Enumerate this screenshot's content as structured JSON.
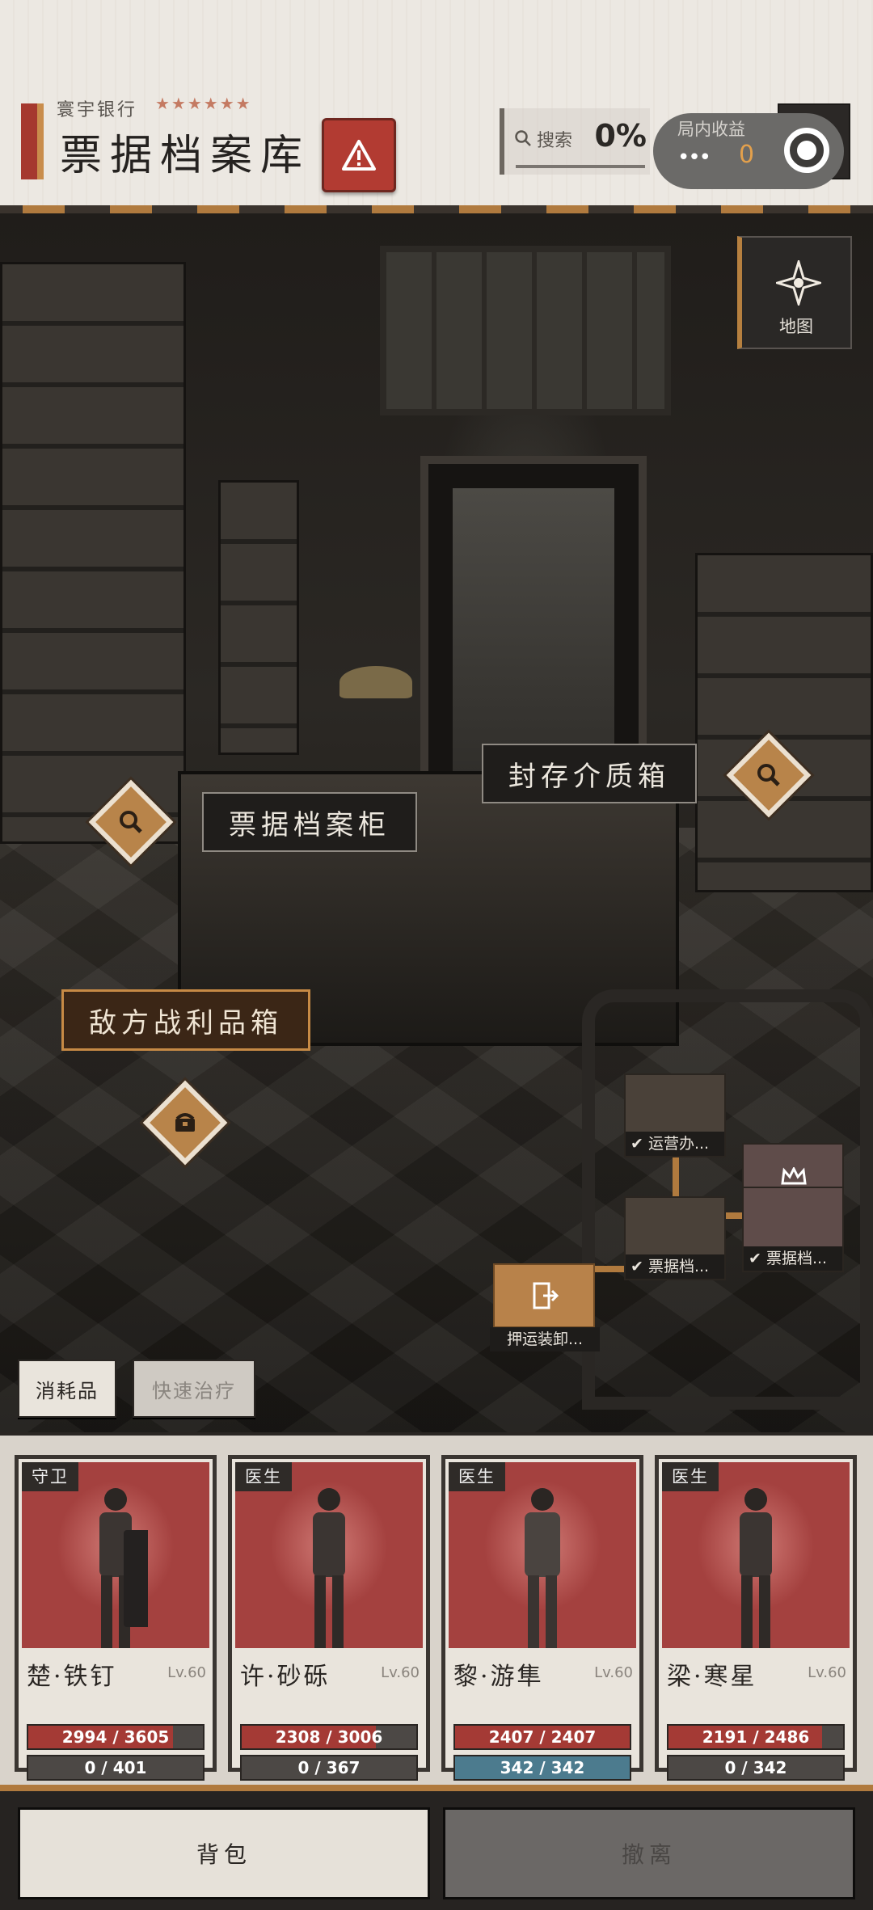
{
  "header": {
    "bank_name": "寰宇银行",
    "stars": "★★★★★★",
    "title": "票据档案库",
    "search_label": "搜索",
    "search_percent": "0%",
    "income_label": "局内收益",
    "income_dots": "•••",
    "income_value": "0"
  },
  "map": {
    "label": "地图"
  },
  "scene": {
    "labels": {
      "cabinet": "票据档案柜",
      "sealed_box": "封存介质箱",
      "loot_box": "敌方战利品箱"
    }
  },
  "minimap": {
    "rooms": [
      {
        "label": "运营办...",
        "checked": true
      },
      {
        "label": "票据档...",
        "checked": true
      },
      {
        "label": "票据档...",
        "checked": true,
        "crown": true
      }
    ],
    "exit_label": "押运装卸..."
  },
  "quick": {
    "consumables": "消耗品",
    "quick_heal": "快速治疗"
  },
  "team": [
    {
      "role": "守卫",
      "name": "楚·铁钉",
      "level": "Lv.60",
      "hp": "2994 / 3605",
      "hp_frac": 0.83,
      "sp": "0 / 401",
      "sp_frac": 0
    },
    {
      "role": "医生",
      "name": "许·砂砾",
      "level": "Lv.60",
      "hp": "2308 / 3006",
      "hp_frac": 0.77,
      "sp": "0 / 367",
      "sp_frac": 0
    },
    {
      "role": "医生",
      "name": "黎·游隼",
      "level": "Lv.60",
      "hp": "2407 / 2407",
      "hp_frac": 1.0,
      "sp": "342 / 342",
      "sp_frac": 1.0
    },
    {
      "role": "医生",
      "name": "梁·寒星",
      "level": "Lv.60",
      "hp": "2191 / 2486",
      "hp_frac": 0.88,
      "sp": "0 / 342",
      "sp_frac": 0
    }
  ],
  "bottom": {
    "bag": "背包",
    "evacuate": "撤离"
  },
  "colors": {
    "accent_red": "#a5392f",
    "accent_gold": "#b07a3e",
    "hp_red": "#a43a35",
    "sp_blue": "#4c7b8e"
  }
}
